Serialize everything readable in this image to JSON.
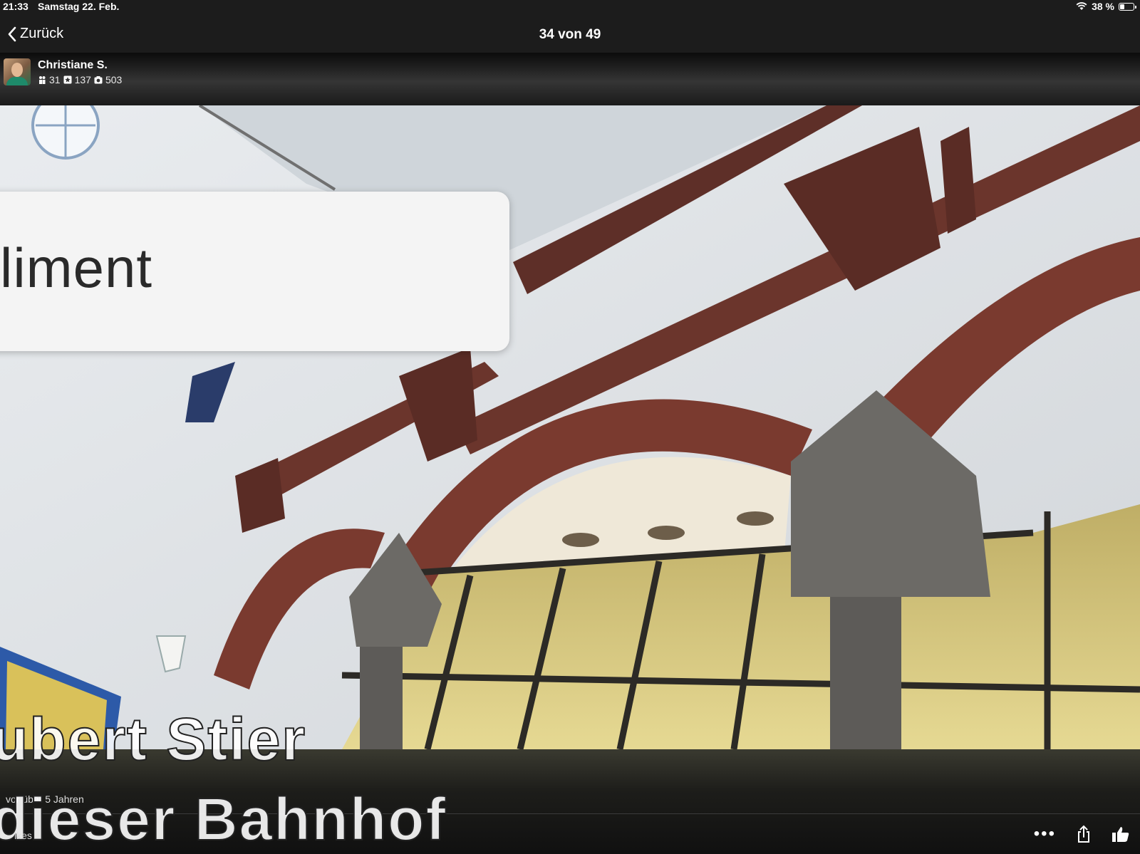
{
  "status_bar": {
    "time": "21:33",
    "date": "Samstag 22. Feb.",
    "battery": "38 %",
    "battery_level": 0.38
  },
  "nav": {
    "back_label": "Zurück",
    "title": "34 von 49"
  },
  "user": {
    "name": "Christiane S.",
    "followers": "31",
    "reviews": "137",
    "photos": "503"
  },
  "photo": {
    "callout_text": "liment"
  },
  "overlay": {
    "caption_line_1": "ubert Stier",
    "caption_line_2": "dieser Bahnhof",
    "age": "vor über 5 Jahren",
    "likes": "ikes"
  },
  "icons": {
    "back": "chevron-left-icon",
    "wifi": "wifi-icon",
    "more": "more-icon",
    "share": "share-icon",
    "like": "thumbs-up-icon"
  }
}
